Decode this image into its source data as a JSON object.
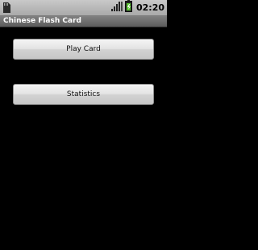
{
  "status_bar": {
    "time": "02:20",
    "icons": [
      "sd-card-icon",
      "signal-icon",
      "battery-icon"
    ]
  },
  "app": {
    "title": "Chinese Flash Card"
  },
  "buttons": {
    "play_card": "Play Card",
    "statistics": "Statistics"
  }
}
